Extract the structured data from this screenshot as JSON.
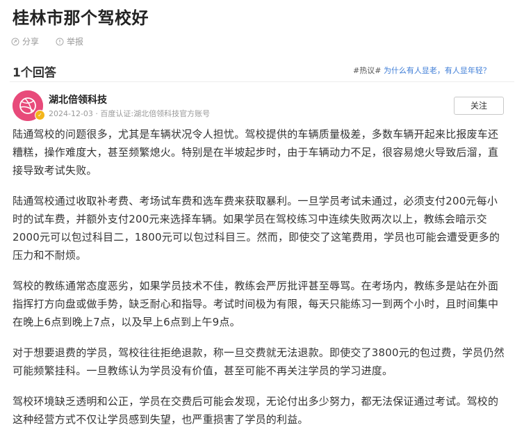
{
  "question": {
    "title": "桂林市那个驾校好",
    "share_label": "分享",
    "report_label": "举报"
  },
  "answers_header": {
    "count_label": "1个回答",
    "hot_tag": "#热议#",
    "hot_question": "为什么有人显老，有人显年轻？"
  },
  "answer": {
    "author": "湖北倍领科技",
    "meta": "2024-12-03 · 百度认证:湖北倍领科技官方账号",
    "follow_label": "关注",
    "paragraphs": [
      "陆通驾校的问题很多，尤其是车辆状况令人担忧。驾校提供的车辆质量极差，多数车辆开起来比报废车还糟糕，操作难度大，甚至频繁熄火。特别是在半坡起步时，由于车辆动力不足，很容易熄火导致后溜，直接导致考试失败。",
      "陆通驾校通过收取补考费、考场试车费和选车费来获取暴利。一旦学员考试未通过，必须支付200元每小时的试车费，并额外支付200元来选择车辆。如果学员在驾校练习中连续失败两次以上，教练会暗示交2000元可以包过科目二，1800元可以包过科目三。然而，即使交了这笔费用，学员也可能会遭受更多的压力和不耐烦。",
      "驾校的教练通常态度恶劣，如果学员技术不佳，教练会严厉批评甚至辱骂。在考场内，教练多是站在外面指挥打方向盘或做手势，缺乏耐心和指导。考试时间极为有限，每天只能练习一到两个小时，且时间集中在晚上6点到晚上7点，以及早上6点到上午9点。",
      "对于想要退费的学员，驾校往往拒绝退款，称一旦交费就无法退款。即使交了3800元的包过费，学员仍然可能频繁挂科。一旦教练认为学员没有价值，甚至可能不再关注学员的学习进度。",
      "驾校环境缺乏透明和公正，学员在交费后可能会发现，无论付出多少努力，都无法保证通过考试。驾校的这种经营方式不仅让学员感到失望，也严重损害了学员的利益。"
    ]
  }
}
